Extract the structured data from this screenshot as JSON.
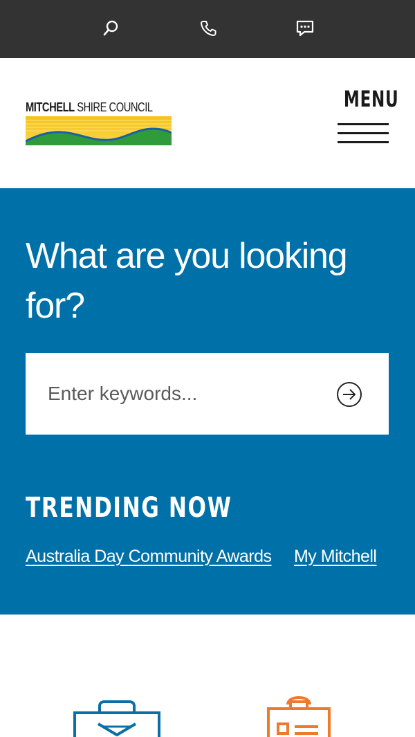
{
  "topbar": {
    "icons": [
      {
        "name": "search-icon"
      },
      {
        "name": "phone-icon"
      },
      {
        "name": "chat-icon"
      }
    ]
  },
  "header": {
    "logo": {
      "bold": "MITCHELL",
      "rest": " SHIRE COUNCIL"
    },
    "menu_label": "MENU"
  },
  "hero": {
    "title": "What are you looking for?",
    "search": {
      "placeholder": "Enter keywords...",
      "value": ""
    },
    "trending_title": "TRENDING NOW",
    "trending_links": [
      "Australia Day Community Awards",
      "My Mitchell"
    ]
  },
  "colors": {
    "topbar": "#333333",
    "hero": "#0070a8",
    "icon_blue": "#0a6fa6",
    "icon_orange": "#ee7a2d"
  }
}
